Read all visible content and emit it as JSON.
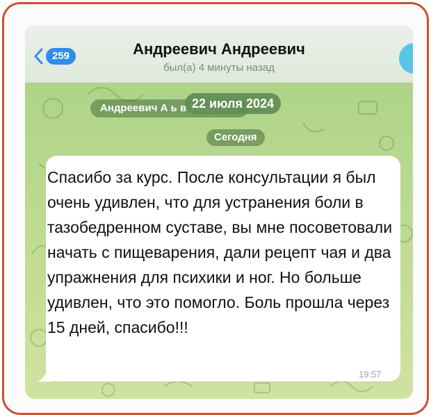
{
  "header": {
    "back_count": "259",
    "contact_name": "Андреевич Андреевич",
    "status": "был(а) 4 минуты назад"
  },
  "chat": {
    "service_message": "Андреевич А                              ь в Telegram!",
    "floating_date": "22 июля 2024",
    "date_separator": "Сегодня",
    "message": {
      "text": "Спасибо за курс. После консультации я был очень удивлен, что для устранения боли в тазобедренном суставе, вы мне посоветовали начать с пищеварения, дали рецепт чая и два упражнения для психики и ног. Но больше удивлен, что это помогло. Боль прошла через 15 дней, спасибо!!!",
      "time": "19:57"
    }
  },
  "colors": {
    "frame_border": "#c9502f",
    "accent": "#2f8ee8",
    "wallpaper": "#b6d78e",
    "pill_bg": "#608c52"
  },
  "icons": {
    "back": "chevron-left-icon",
    "avatar": "avatar"
  }
}
